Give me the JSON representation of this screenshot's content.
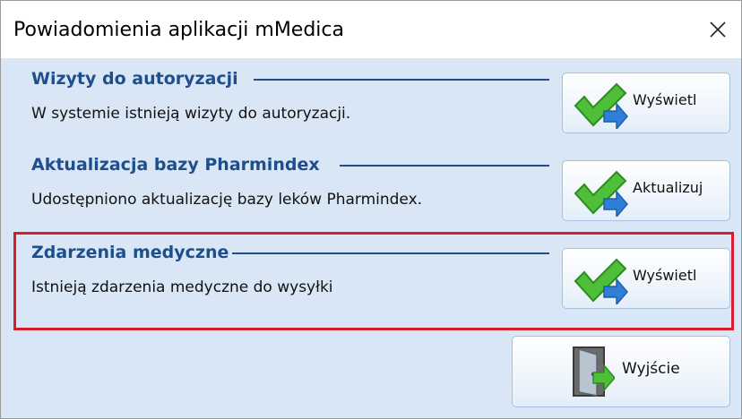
{
  "window": {
    "title": "Powiadomienia aplikacji mMedica",
    "close_icon": "close-icon"
  },
  "notifications": [
    {
      "title": "Wizyty do autoryzacji",
      "description": "W systemie istnieją wizyty do autoryzacji.",
      "button_label": "Wyświetl",
      "icon": "check-arrow-icon"
    },
    {
      "title": "Aktualizacja bazy Pharmindex",
      "description": "Udostępniono aktualizację bazy leków Pharmindex.",
      "button_label": "Aktualizuj",
      "icon": "check-arrow-icon"
    },
    {
      "title": "Zdarzenia medyczne",
      "description": "Istnieją zdarzenia medyczne do wysyłki",
      "button_label": "Wyświetl",
      "icon": "check-arrow-icon",
      "highlighted": true
    }
  ],
  "footer": {
    "exit_label": "Wyjście",
    "exit_icon": "exit-door-icon"
  },
  "colors": {
    "section_title": "#1f4e8c",
    "highlight_border": "#d81d2c",
    "window_background": "#d8e6f5",
    "check": "#4fbf3a",
    "arrow": "#2f7fd8"
  }
}
